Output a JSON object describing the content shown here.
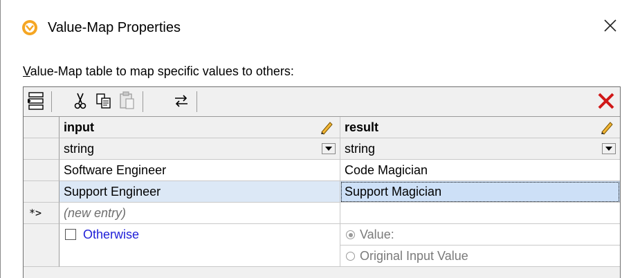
{
  "window": {
    "title": "Value-Map Properties",
    "close_label": "×"
  },
  "description": {
    "first_letter": "V",
    "rest": "alue-Map table to map specific values to others:"
  },
  "toolbar": {
    "buttons": [
      {
        "name": "insert-row-button",
        "icon": "insert-row-icon"
      },
      {
        "name": "cut-button",
        "icon": "scissors-icon"
      },
      {
        "name": "copy-button",
        "icon": "copy-icon"
      },
      {
        "name": "paste-button",
        "icon": "paste-icon"
      },
      {
        "name": "swap-button",
        "icon": "swap-arrows-icon"
      },
      {
        "name": "delete-button",
        "icon": "delete-x-icon"
      }
    ]
  },
  "table": {
    "columns": [
      {
        "header": "input",
        "type": "string"
      },
      {
        "header": "result",
        "type": "string"
      }
    ],
    "rows": [
      {
        "marker": "",
        "input": "Software Engineer",
        "result": "Code Magician"
      },
      {
        "marker": "",
        "input": "Support Engineer",
        "result": "Support Magician",
        "selected": true
      }
    ],
    "new_entry": {
      "marker": "*>",
      "input": "(new entry)",
      "result": ""
    },
    "otherwise": {
      "checkbox_label": "Otherwise",
      "checked": false,
      "radio_value_label": "Value:",
      "radio_original_label": "Original Input Value",
      "selected_option": "Value:"
    }
  },
  "colors": {
    "accent_orange": "#f5a623",
    "delete_red": "#d01818",
    "link_blue": "#1f1fd8",
    "selection_blue": "#cde0f7"
  }
}
